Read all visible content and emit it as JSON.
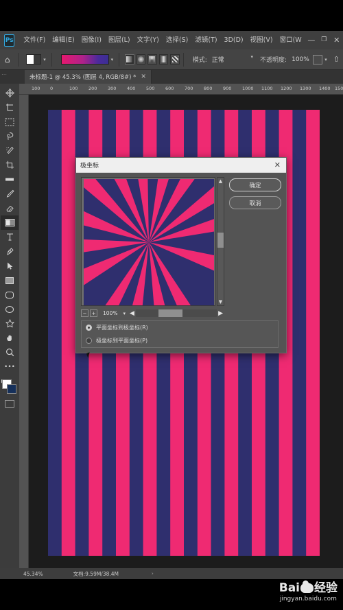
{
  "app": {
    "name": "Adobe Photoshop",
    "logo_text": "Ps"
  },
  "menubar": {
    "items": [
      {
        "label": "文件(F)",
        "name": "menu-file"
      },
      {
        "label": "编辑(E)",
        "name": "menu-edit"
      },
      {
        "label": "图像(I)",
        "name": "menu-image"
      },
      {
        "label": "图层(L)",
        "name": "menu-layer"
      },
      {
        "label": "文字(Y)",
        "name": "menu-type"
      },
      {
        "label": "选择(S)",
        "name": "menu-select"
      },
      {
        "label": "滤镜(T)",
        "name": "menu-filter"
      },
      {
        "label": "3D(D)",
        "name": "menu-3d"
      },
      {
        "label": "视图(V)",
        "name": "menu-view"
      },
      {
        "label": "窗口(W",
        "name": "menu-window"
      }
    ],
    "window_controls": {
      "minimize": "—",
      "maximize": "❐",
      "close": "✕"
    }
  },
  "optionsbar": {
    "home_icon": "⌂",
    "gradient_preset_caret": "▾",
    "gradient_strip_caret": "▾",
    "gradient_types": [
      "linear",
      "radial",
      "angle",
      "reflected",
      "diamond"
    ],
    "mode_label": "模式:",
    "mode_value": "正常",
    "mode_caret": "▾",
    "opacity_label": "不透明度:",
    "opacity_value": "100%",
    "opacity_caret": "▾",
    "share_icon": "⇧"
  },
  "tabbar": {
    "handle": "⋯",
    "document_title": "未标题-1 @ 45.3% (图层 4, RGB/8#) *",
    "close": "✕"
  },
  "ruler": {
    "ticks": [
      "100",
      "0",
      "100",
      "200",
      "300",
      "400",
      "500",
      "600",
      "700",
      "800",
      "900",
      "1000",
      "1100",
      "1200",
      "1300",
      "1400",
      "1500"
    ]
  },
  "tools": [
    {
      "name": "move-tool",
      "glyph": "✥"
    },
    {
      "name": "artboard-tool",
      "glyph": "⬚"
    },
    {
      "name": "marquee-tool",
      "glyph": "▭"
    },
    {
      "name": "lasso-tool",
      "glyph": "◌"
    },
    {
      "name": "magic-wand-tool",
      "glyph": "✨"
    },
    {
      "name": "crop-tool",
      "glyph": "⌗"
    },
    {
      "name": "eyedropper-tool",
      "glyph": "▰"
    },
    {
      "name": "brush-tool",
      "glyph": "✎"
    },
    {
      "name": "eraser-tool",
      "glyph": "◣"
    },
    {
      "name": "gradient-tool",
      "glyph": "▤",
      "active": true
    },
    {
      "name": "type-tool",
      "glyph": "T"
    },
    {
      "name": "pen-tool",
      "glyph": "✒"
    },
    {
      "name": "path-selection-tool",
      "glyph": "➤"
    },
    {
      "name": "rectangle-tool",
      "glyph": "▢"
    },
    {
      "name": "rounded-rectangle-tool",
      "glyph": "▭"
    },
    {
      "name": "ellipse-tool",
      "glyph": "◯"
    },
    {
      "name": "custom-shape-tool",
      "glyph": "✿"
    },
    {
      "name": "hand-tool",
      "glyph": "✋"
    },
    {
      "name": "zoom-tool",
      "glyph": "⌕"
    },
    {
      "name": "more-tools",
      "glyph": "•••"
    }
  ],
  "colors": {
    "stripe_dark": "#2f2f6e",
    "stripe_pink": "#ef2a72",
    "foreground": "#ffffff",
    "background": "#16305a",
    "accent_blue": "#31a8e0",
    "canvas_bg": "#1c1c1c",
    "panel_bg": "#3c3c3c",
    "dialog_bg": "#545454"
  },
  "canvas": {
    "stripe_count": 20,
    "description": "vertical pink and navy stripe pattern"
  },
  "dialog": {
    "title": "极坐标",
    "close": "✕",
    "preview": {
      "zoom_out": "−",
      "zoom_in": "+",
      "zoom_value": "100%",
      "zoom_caret": "▾",
      "scroll_left": "◀",
      "scroll_right": "▶",
      "scroll_up": "▲",
      "scroll_down": "▼",
      "description": "radial sunburst of pink and navy wedges"
    },
    "options": [
      {
        "label": "平面坐标到极坐标(R)",
        "selected": true,
        "name": "radio-rect-to-polar"
      },
      {
        "label": "极坐标到平面坐标(P)",
        "selected": false,
        "name": "radio-polar-to-rect"
      }
    ],
    "buttons": [
      {
        "label": "确定",
        "name": "ok-button",
        "primary": true
      },
      {
        "label": "取消",
        "name": "cancel-button",
        "primary": false
      }
    ]
  },
  "statusbar": {
    "zoom": "45.34%",
    "document_info": "文档:9.59M/38.4M",
    "arrow": "›"
  },
  "watermark": {
    "brand_a": "Bai",
    "brand_b": "du",
    "brand_c": "经验",
    "url": "jingyan.baidu.com"
  }
}
